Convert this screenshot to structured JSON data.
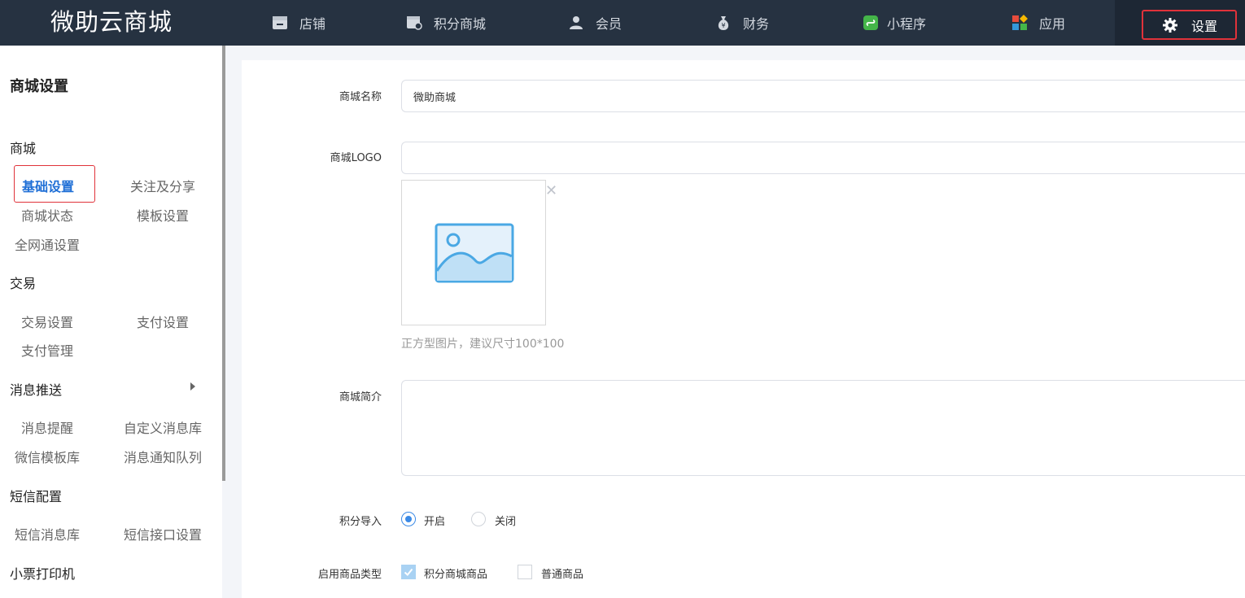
{
  "app": {
    "brand": "微助云商城"
  },
  "topnav": {
    "items": [
      {
        "label": "店铺",
        "icon": "store-icon"
      },
      {
        "label": "积分商城",
        "icon": "points-mall-icon"
      },
      {
        "label": "会员",
        "icon": "member-icon"
      },
      {
        "label": "财务",
        "icon": "money-bag-icon"
      },
      {
        "label": "小程序",
        "icon": "mini-program-icon"
      },
      {
        "label": "应用",
        "icon": "apps-icon"
      }
    ],
    "settings_label": "设置"
  },
  "sidebar": {
    "title": "商城设置",
    "groups": [
      {
        "label": "商城",
        "links": [
          "基础设置",
          "关注及分享",
          "商城状态",
          "模板设置",
          "全网通设置"
        ]
      },
      {
        "label": "交易",
        "links": [
          "交易设置",
          "支付设置",
          "支付管理"
        ]
      },
      {
        "label": "消息推送",
        "links": [
          "消息提醒",
          "自定义消息库",
          "微信模板库",
          "消息通知队列"
        ]
      },
      {
        "label": "短信配置",
        "links": [
          "短信消息库",
          "短信接口设置"
        ]
      },
      {
        "label": "小票打印机",
        "links": []
      }
    ],
    "active": "基础设置"
  },
  "form": {
    "name_label": "商城名称",
    "name_value": "微助商城",
    "logo_label": "商城LOGO",
    "logo_value": "",
    "logo_hint": "正方型图片，建议尺寸100*100",
    "intro_label": "商城简介",
    "intro_value": "",
    "points_import_label": "积分导入",
    "points_import_options": [
      "开启",
      "关闭"
    ],
    "points_import_selected": "开启",
    "goods_type_label": "启用商品类型",
    "goods_type_options": [
      "积分商城商品",
      "普通商品"
    ],
    "goods_type_checked": [
      "积分商城商品"
    ]
  },
  "colors": {
    "topbar_bg": "#263241",
    "accent_red": "#e0323a",
    "active_blue": "#1f6fd6",
    "radio_blue": "#3b8ae6",
    "image_icon_blue": "#4aa8e4"
  }
}
